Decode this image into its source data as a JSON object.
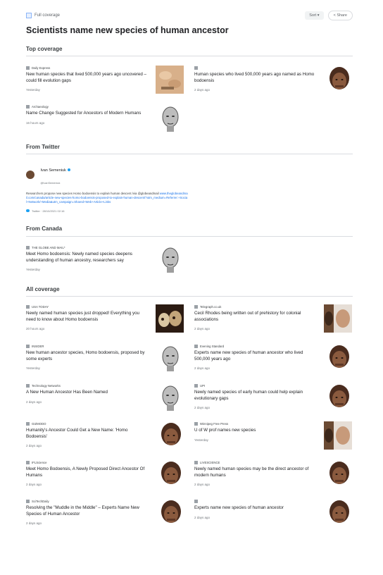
{
  "header": {
    "label": "Full coverage",
    "sort_label": "Sort ▾",
    "share_label": "< Share"
  },
  "title": "Scientists name new species of human ancestor",
  "sections": {
    "top": "Top coverage",
    "twitter": "From Twitter",
    "canada": "From Canada",
    "all": "All coverage"
  },
  "tweet": {
    "name": "Ivan Semeniuk",
    "handle": "@IvanSemeniuk",
    "text": "Researchers propose new species Homo bodoensis to explain human descent /via @globeandmail ",
    "link": "www.theglobeandmail.com/canada/article-new-species-homo-bodoensis-proposed-to-explain-human-descent/?utm_medium=Referrer:+Social+Network/+Media&utm_campaign=Shared+Web+Article+Links",
    "footer": "Twitter · 28/10/2021 02:16"
  },
  "cards": [
    {
      "source": "Daily Express",
      "headline": "New human species that lived 500,000 years ago uncovered – could fill evolution gaps",
      "time": "Yesterday",
      "thumb": "hands-icon"
    },
    {
      "source": "",
      "headline": "Human species who lived 500,000 years ago named as Homo bodoensis",
      "time": "2 days ago",
      "thumb": "hominin-icon"
    },
    {
      "source": "Archaeology",
      "headline": "Name Change Suggested for Ancestors of Modern Humans",
      "time": "16 hours ago",
      "thumb": "sketch-head-icon"
    },
    {
      "source": "THE GLOBE AND MAIL*",
      "headline": "Meet Homo bodoensis: Newly named species deepens understanding of human ancestry, researchers say",
      "time": "Yesterday",
      "thumb": "sketch-head-icon"
    },
    {
      "source": "USA TODAY",
      "headline": "Newly named human species just dropped! Everything you need to know about Homo bodoensis",
      "time": "20 hours ago",
      "thumb": "skulls-icon"
    },
    {
      "source": "Telegraph.co.uk",
      "headline": "Cecil Rhodes being written out of prehistory for colonial associations",
      "time": "2 days ago",
      "thumb": "faces-icon"
    },
    {
      "source": "INSIDER",
      "headline": "New human ancestor species, Homo bodoensis, proposed by some experts",
      "time": "Yesterday",
      "thumb": "sketch-head-icon"
    },
    {
      "source": "Evening Standard",
      "headline": "Experts name new species of human ancestor who lived 500,000 years ago",
      "time": "2 days ago",
      "thumb": "hominin-icon"
    },
    {
      "source": "Technology Networks",
      "headline": "A New Human Ancestor Has Been Named",
      "time": "2 days ago",
      "thumb": "sketch-head-icon"
    },
    {
      "source": "UPI",
      "headline": "Newly named species of early human could help explain evolutionary gaps",
      "time": "2 days ago",
      "thumb": "hominin-icon"
    },
    {
      "source": "GIZMODO",
      "headline": "Humanity's Ancestor Could Get a New Name: 'Homo Bodoensis'",
      "time": "2 days ago",
      "thumb": "hominin-icon"
    },
    {
      "source": "Winnipeg Free Press",
      "headline": "U of W prof names new species",
      "time": "Yesterday",
      "thumb": "faces-icon"
    },
    {
      "source": "IFLScience",
      "headline": "Meet Homo Bodoensis, A Newly Proposed Direct Ancestor Of Humans",
      "time": "2 days ago",
      "thumb": "hominin-icon"
    },
    {
      "source": "LIVESCIENCE",
      "headline": "Newly named human species may be the direct ancestor of modern humans",
      "time": "2 days ago",
      "thumb": "hominin-icon"
    },
    {
      "source": "SciTechDaily",
      "headline": "Resolving the \"Muddle in the Middle\" – Experts Name New Species of Human Ancestor",
      "time": "2 days ago",
      "thumb": "hominin-icon"
    },
    {
      "source": "",
      "headline": "Experts name new species of human ancestor",
      "time": "2 days ago",
      "thumb": "hominin-icon"
    }
  ]
}
